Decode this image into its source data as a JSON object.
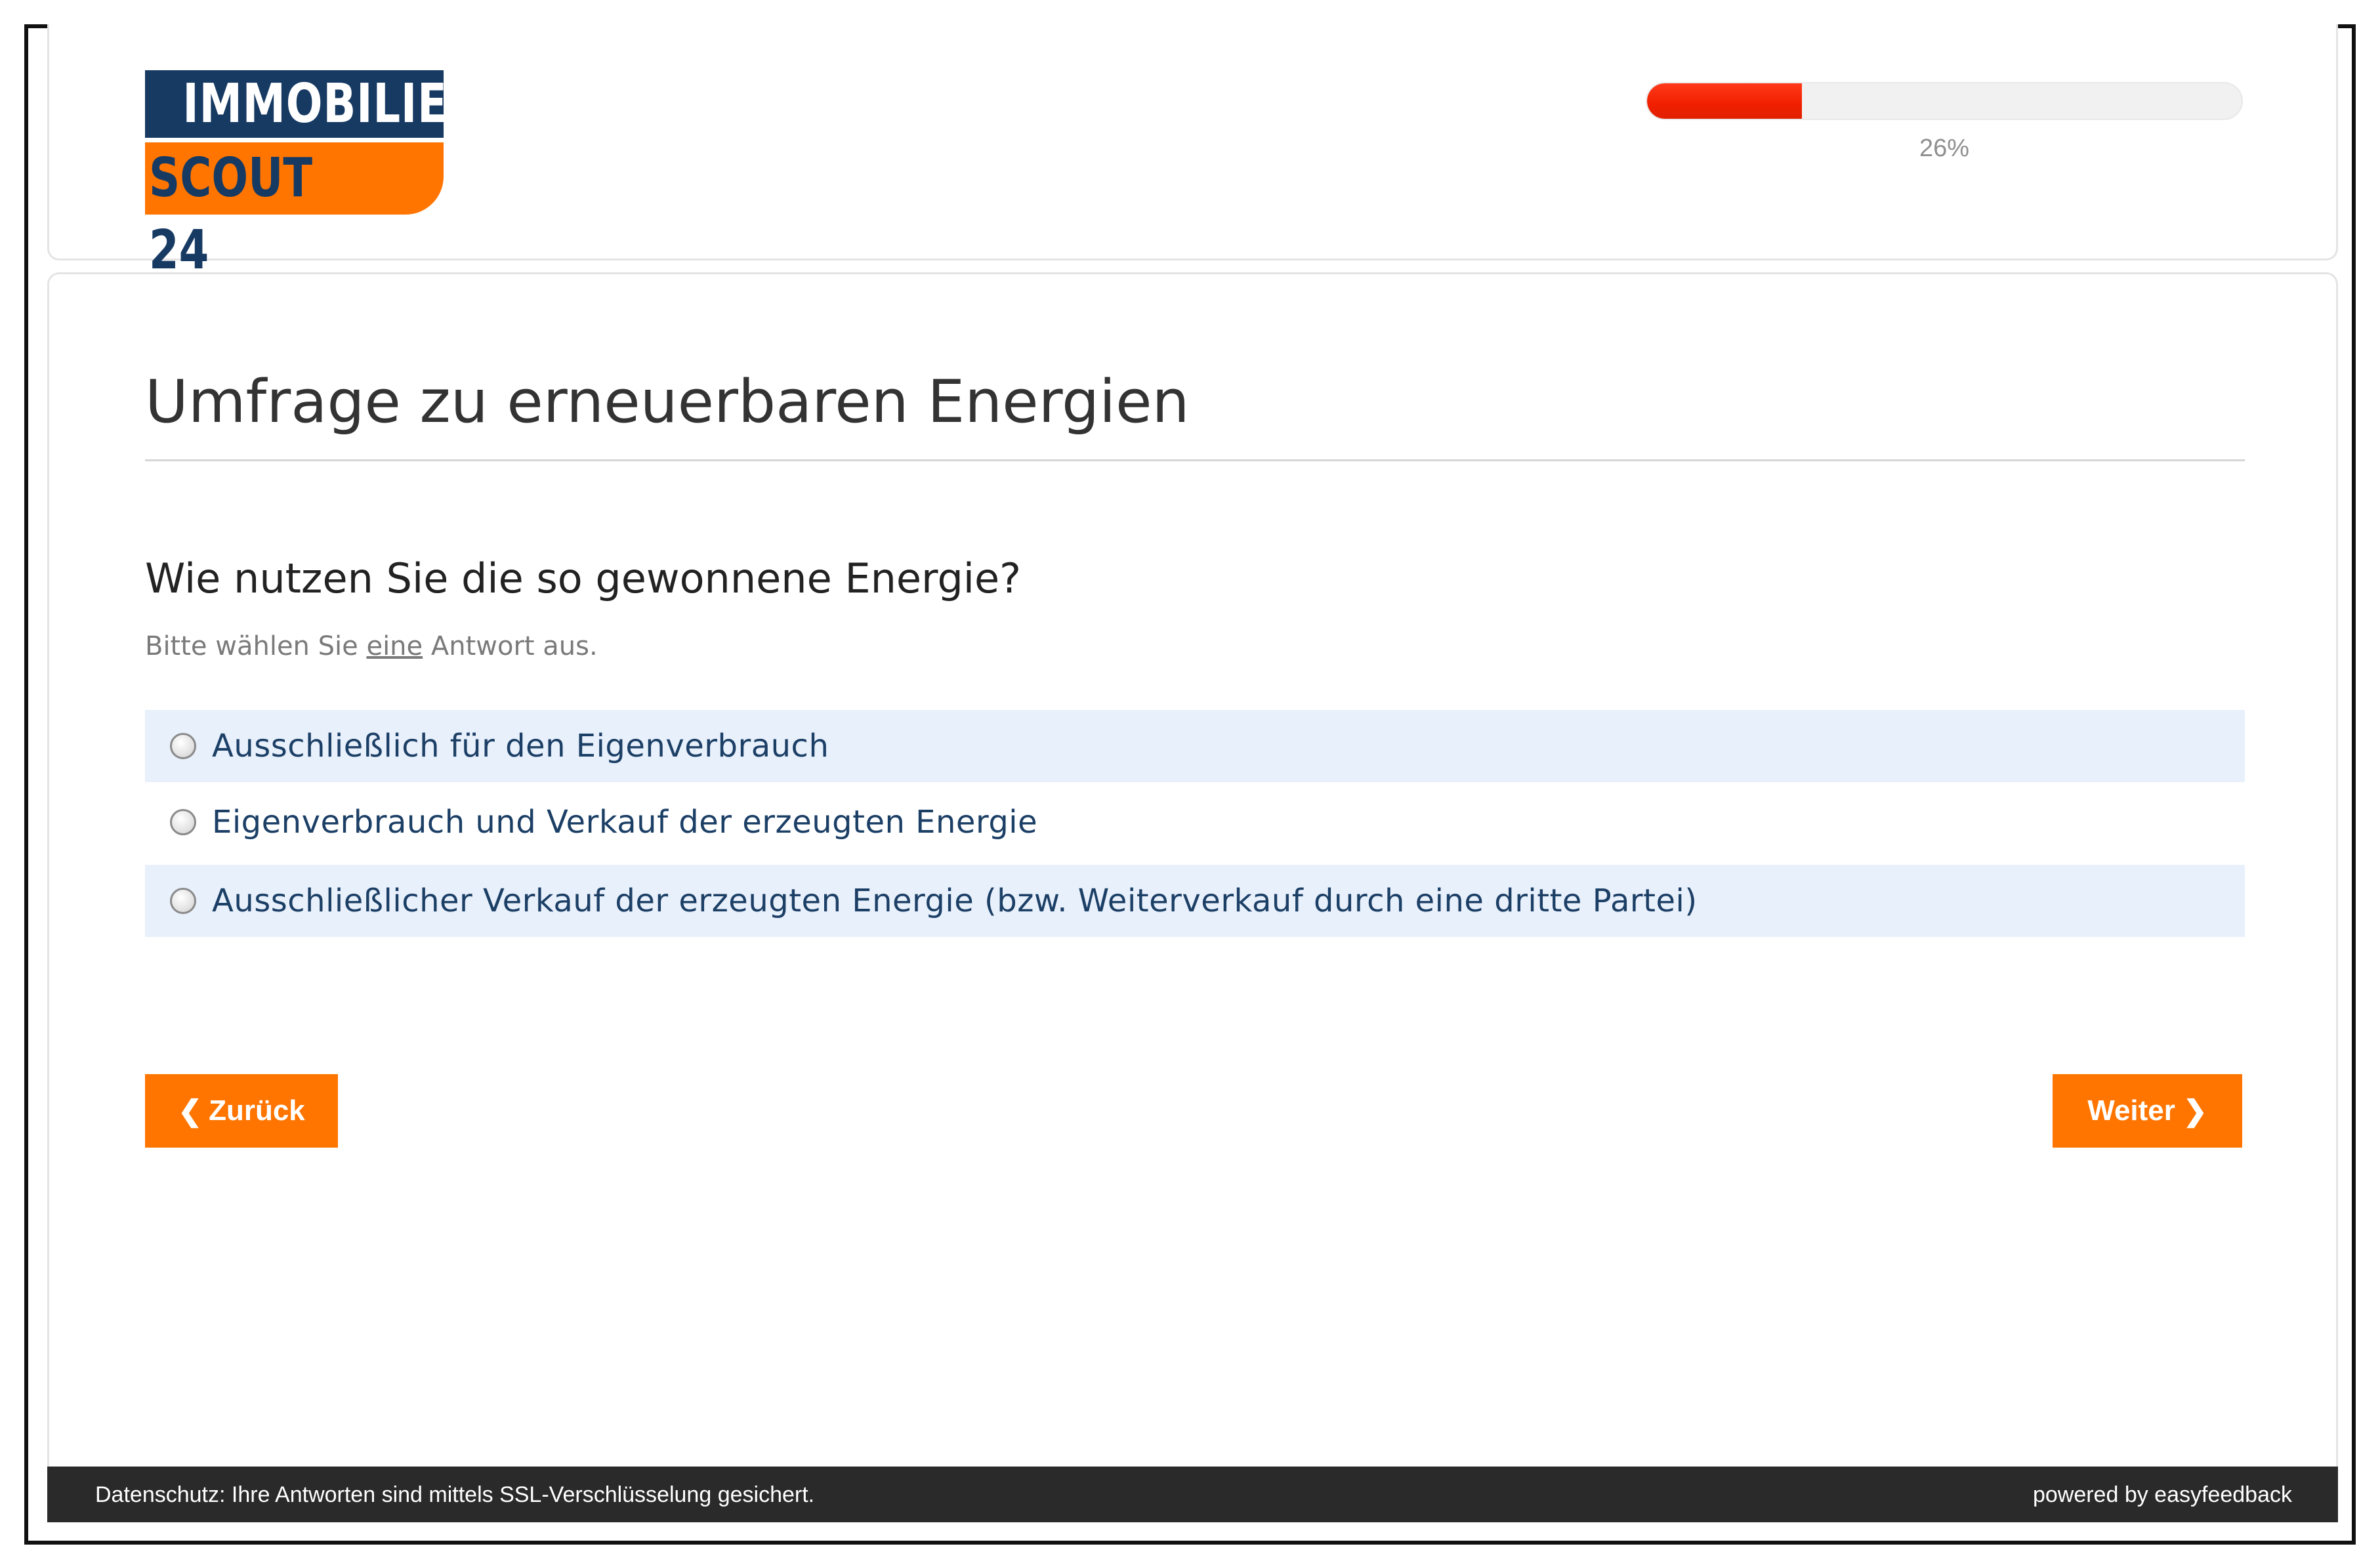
{
  "logo": {
    "line1": "IMMOBILIEN",
    "line2": "SCOUT 24"
  },
  "progress": {
    "value": 0.26,
    "label": "26%"
  },
  "survey": {
    "title": "Umfrage zu erneuerbaren Energien"
  },
  "question": {
    "text": "Wie nutzen Sie die so gewonnene Energie?",
    "hint_before": "Bitte wählen Sie ",
    "hint_emphasis": "eine",
    "hint_after": " Antwort aus.",
    "options": [
      {
        "label": "Ausschließlich für den Eigenverbrauch",
        "selected": false
      },
      {
        "label": "Eigenverbrauch und Verkauf der erzeugten Energie",
        "selected": false
      },
      {
        "label": "Ausschließlicher Verkauf der erzeugten Energie (bzw. Weiterverkauf durch eine dritte Partei)",
        "selected": false
      }
    ]
  },
  "nav": {
    "back_label": "Zurück",
    "next_label": "Weiter",
    "back_icon": "chevron-left-icon",
    "next_icon": "chevron-right-icon"
  },
  "footer": {
    "privacy_text": "Datenschutz: Ihre Antworten sind mittels SSL-Verschlüsselung gesichert.",
    "powered_by": "powered by easyfeedback"
  },
  "colors": {
    "brand_orange": "#ff7500",
    "brand_navy": "#173a63",
    "progress_red": "#f01f00",
    "option_highlight": "#e8f0fb",
    "footer_bg": "#2a2a2a"
  }
}
